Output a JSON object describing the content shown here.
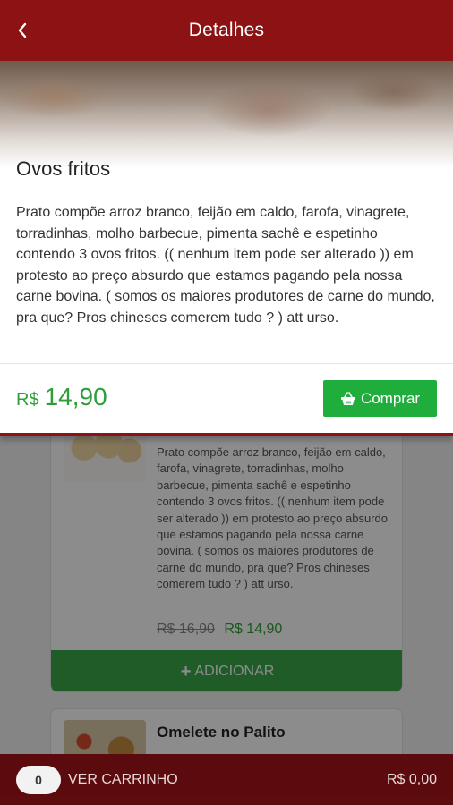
{
  "header": {
    "back_icon": "chevron-left-icon",
    "title": "Detalhes"
  },
  "details": {
    "name": "Ovos fritos",
    "description": "Prato compõe arroz branco, feijão em caldo, farofa, vinagrete, torradinhas, molho barbecue, pimenta sachê e espetinho contendo 3 ovos fritos. (( nenhum item pode ser alterado )) em protesto ao preço absurdo que estamos pagando pela nossa carne bovina. ( somos os maiores produtores de carne do mundo, pra que? Pros chineses comerem tudo ? ) att urso.",
    "currency": "R$",
    "price": "14,90",
    "buy_icon": "basket-icon",
    "buy_label": "Comprar"
  },
  "background_list": {
    "item1": {
      "description": "Prato compõe arroz branco, feijão em caldo, farofa, vinagrete, torradinhas, molho barbecue, pimenta sachê e espetinho contendo 3 ovos fritos. (( nenhum item pode ser alterado )) em protesto ao preço absurdo que estamos pagando pela nossa carne bovina. ( somos os maiores produtores de carne do mundo, pra que? Pros chineses comerem tudo ? ) att urso.",
      "old_price": "R$ 16,90",
      "new_price": "R$ 14,90",
      "add_label": "ADICIONAR"
    },
    "item2": {
      "name": "Omelete no Palito"
    }
  },
  "cart": {
    "count": "0",
    "label": "VER CARRINHO",
    "total": "R$ 0,00"
  },
  "colors": {
    "brand_red": "#8d1214",
    "price_green": "#2e9e3a",
    "button_green": "#1fae3c"
  }
}
